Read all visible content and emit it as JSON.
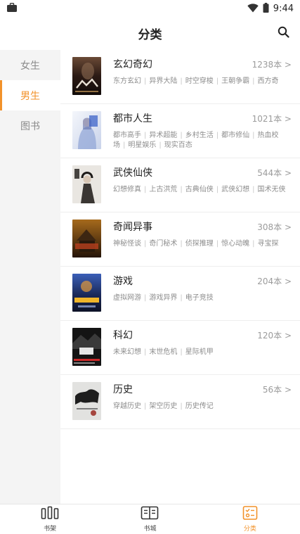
{
  "status_bar": {
    "time": "9:44",
    "icons": [
      "briefcase-icon",
      "wifi-icon",
      "battery-icon"
    ]
  },
  "header": {
    "title": "分类",
    "search_icon": "search-icon"
  },
  "sidebar": {
    "items": [
      {
        "label": "女生",
        "active": false
      },
      {
        "label": "男生",
        "active": true
      },
      {
        "label": "图书",
        "active": false
      }
    ]
  },
  "categories": [
    {
      "name": "玄幻奇幻",
      "count": "1238本 >",
      "tags": [
        "东方玄幻",
        "异界大陆",
        "时空穿梭",
        "王朝争霸",
        "西方奇"
      ]
    },
    {
      "name": "都市人生",
      "count": "1021本 >",
      "tags": [
        "都市高手",
        "异术超能",
        "乡村生活",
        "都市修仙",
        "热血校场",
        "明星娱乐",
        "现实百态"
      ]
    },
    {
      "name": "武侠仙侠",
      "count": "544本 >",
      "tags": [
        "幻想修真",
        "上古洪荒",
        "古典仙侠",
        "武侠幻想",
        "国术无侠"
      ]
    },
    {
      "name": "奇闻异事",
      "count": "308本 >",
      "tags": [
        "神秘怪谈",
        "奇门秘术",
        "侦探推理",
        "惊心动魄",
        "寻宝探"
      ]
    },
    {
      "name": "游戏",
      "count": "204本 >",
      "tags": [
        "虚拟网游",
        "游戏异界",
        "电子竞技"
      ]
    },
    {
      "name": "科幻",
      "count": "120本 >",
      "tags": [
        "未来幻想",
        "末世危机",
        "星际机甲"
      ]
    },
    {
      "name": "历史",
      "count": "56本 >",
      "tags": [
        "穿越历史",
        "架空历史",
        "历史传记"
      ]
    }
  ],
  "bottom_nav": {
    "items": [
      {
        "label": "书架",
        "icon": "bookshelf-icon",
        "active": false
      },
      {
        "label": "书城",
        "icon": "book-store-icon",
        "active": false
      },
      {
        "label": "分类",
        "icon": "category-icon",
        "active": true
      }
    ]
  },
  "colors": {
    "accent": "#f2922a",
    "sidebar_bg": "#f4f4f4",
    "divider": "#eeeeee"
  }
}
